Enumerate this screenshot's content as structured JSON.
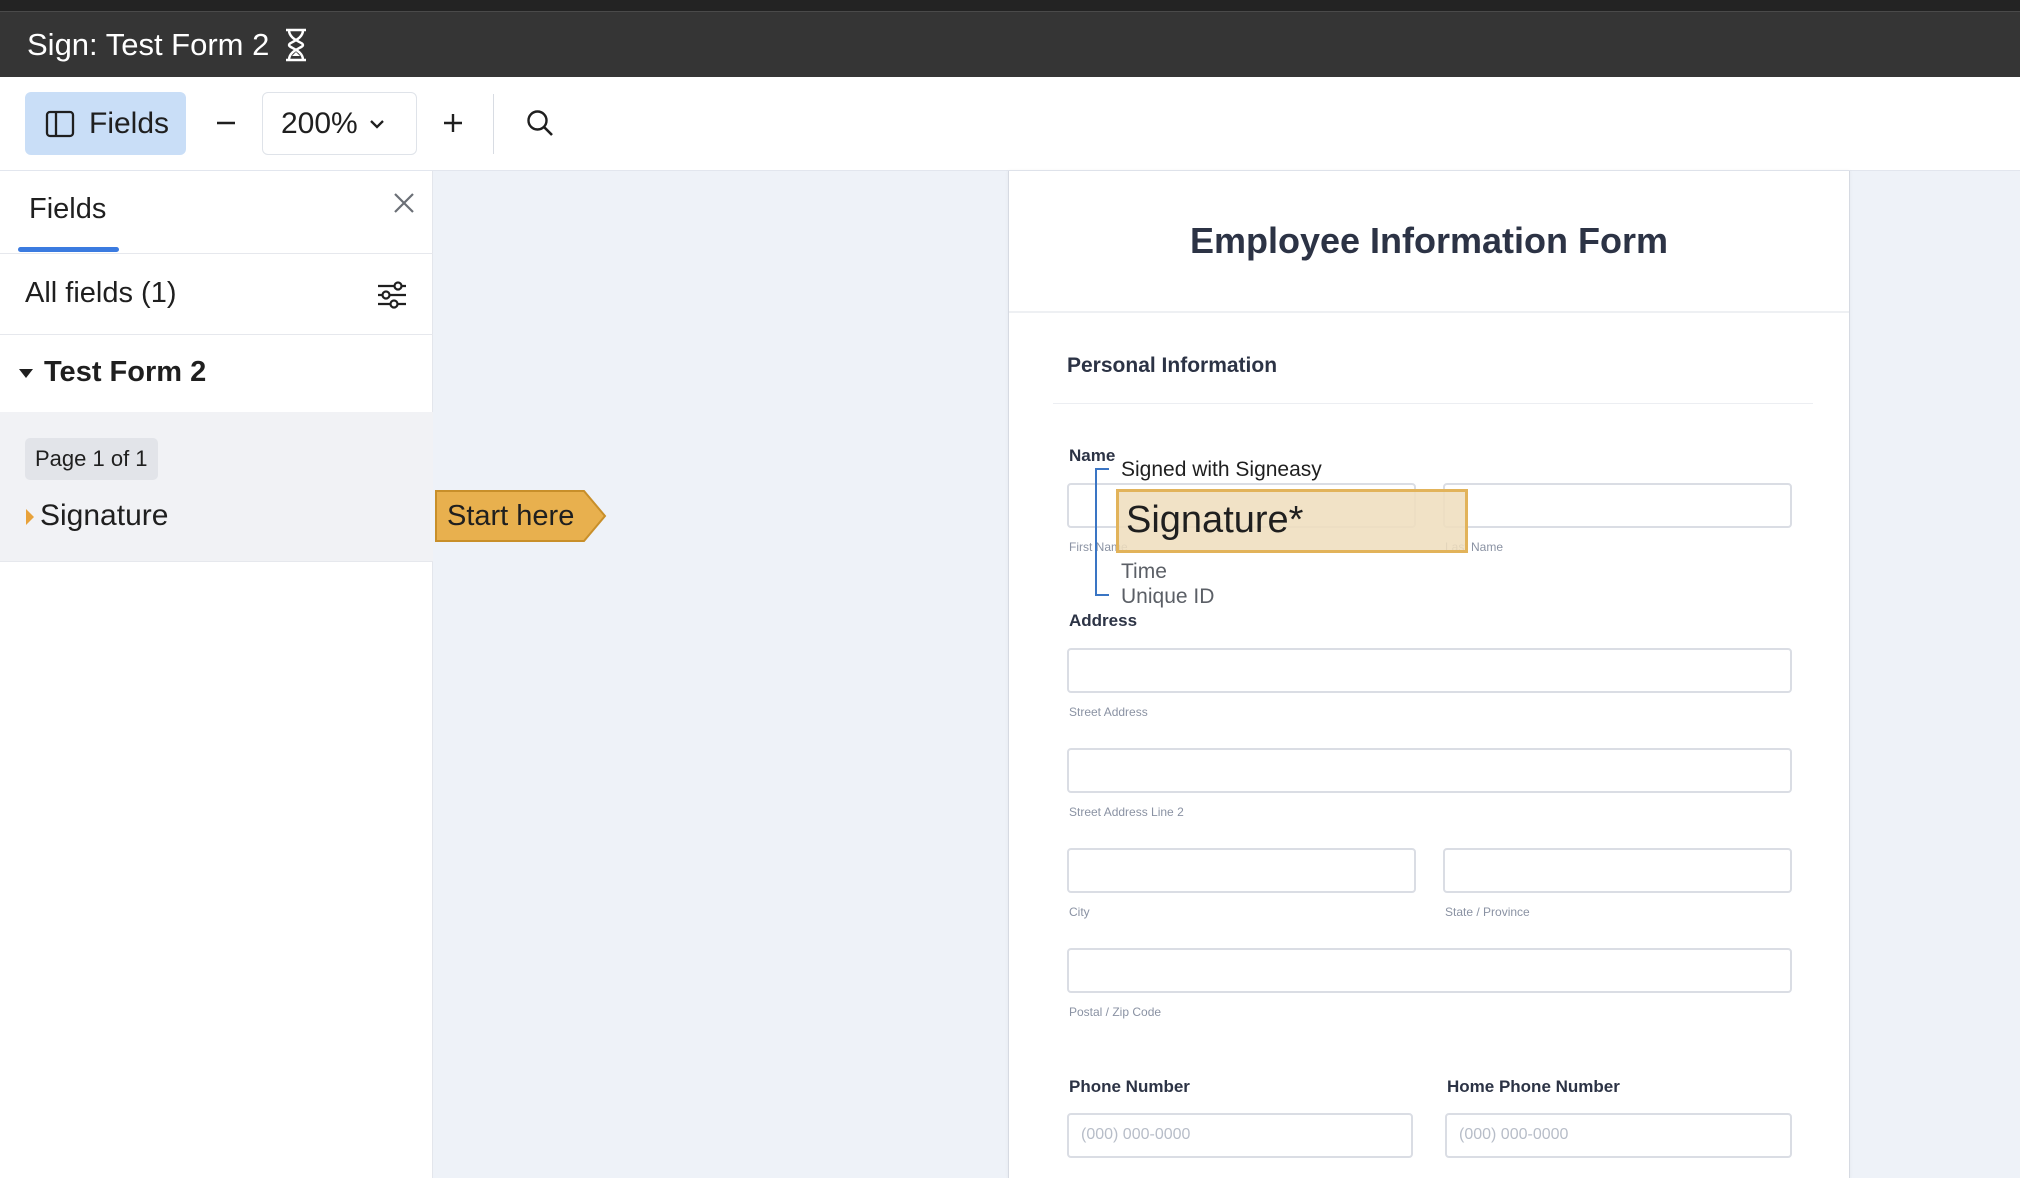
{
  "window": {
    "title": "Sign: Test Form 2"
  },
  "toolbar": {
    "fields_label": "Fields",
    "zoom": "200%"
  },
  "sidebar": {
    "tab_label": "Fields",
    "all_fields_label": "All fields (1)",
    "document_name": "Test Form 2",
    "page_badge": "Page 1 of 1",
    "field_label": "Signature"
  },
  "start_tag": "Start here",
  "document": {
    "title": "Employee Information Form",
    "section": "Personal Information",
    "name_label": "Name",
    "first_name_sub": "First Name",
    "last_name_sub": "Last Name",
    "address_label": "Address",
    "street_sub": "Street Address",
    "street2_sub": "Street Address Line 2",
    "city_sub": "City",
    "state_sub": "State / Province",
    "zip_sub": "Postal / Zip Code",
    "phone_label": "Phone Number",
    "home_phone_label": "Home Phone Number",
    "phone_placeholder": "(000) 000-0000",
    "home_phone_placeholder": "(000) 000-0000"
  },
  "signature_field": {
    "signed_with": "Signed with Signeasy",
    "label": "Signature*",
    "time_label": "Time",
    "uid_label": "Unique ID"
  },
  "colors": {
    "accent": "#3b7be0",
    "tag": "#e8b04e",
    "titlebar": "#353535",
    "fields_button": "#c9def7"
  }
}
